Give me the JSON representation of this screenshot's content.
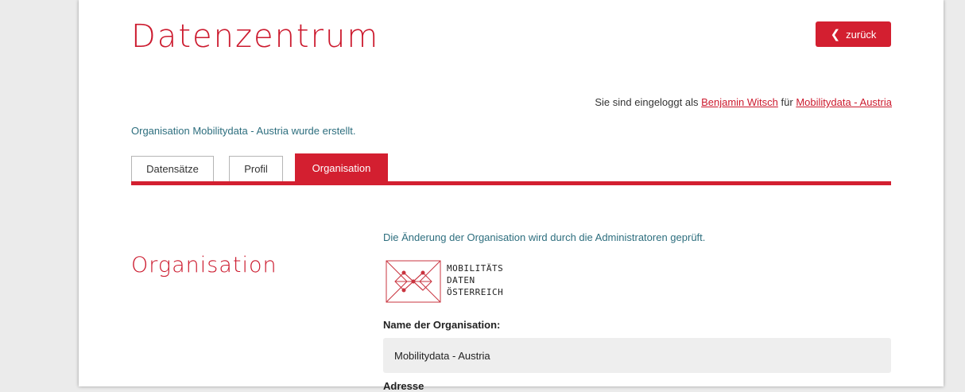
{
  "header": {
    "title": "Datenzentrum",
    "back_label": "zurück"
  },
  "login": {
    "prefix": "Sie sind eingeloggt als",
    "user": "Benjamin Witsch",
    "middle": "für",
    "organisation": "Mobilitydata - Austria"
  },
  "flash_message": "Organisation Mobilitydata - Austria wurde erstellt.",
  "tabs": [
    {
      "label": "Datensätze",
      "active": false
    },
    {
      "label": "Profil",
      "active": false
    },
    {
      "label": "Organisation",
      "active": true
    }
  ],
  "section": {
    "title": "Organisation"
  },
  "form": {
    "notice": "Die Änderung der Organisation wird durch die Administratoren geprüft.",
    "logo_lines": [
      "MOBILITÄTS",
      "DATEN",
      "ÖSTERREICH"
    ],
    "name_label": "Name der Organisation:",
    "name_value": "Mobilitydata - Austria",
    "next_label": "Adresse"
  },
  "colors": {
    "accent": "#d31f30",
    "title": "#cc1a2e",
    "info_text": "#2d6e7e",
    "background": "#ebebeb"
  }
}
